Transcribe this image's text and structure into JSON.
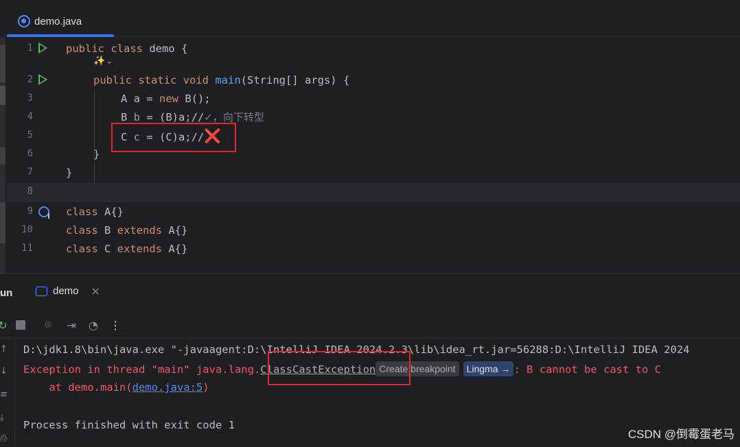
{
  "editor": {
    "tab_label": "demo.java",
    "line_numbers": [
      "1",
      "2",
      "3",
      "4",
      "5",
      "6",
      "7",
      "8",
      "9",
      "10",
      "11"
    ],
    "lines": {
      "l1_kw": "public class",
      "l1_rest": " demo {",
      "l2_kw": "public static void",
      "l2_fn": "main",
      "l2_rest": "(String[] args) {",
      "l3_a": "A a = ",
      "l3_kw": "new",
      "l3_b": " B();",
      "l4_a": "B ",
      "l4_var": "b",
      "l4_b": " = (B)a;//",
      "l4_comment": "✓，向下转型",
      "l5_a": "C ",
      "l5_var": "c",
      "l5_b": " = (C)a;//",
      "l5_cross": "❌",
      "l6": "}",
      "l7": "}",
      "l9_kw": "class",
      "l9_rest": " A{}",
      "l10_kw1": "class",
      "l10_mid": " B ",
      "l10_kw2": "extends",
      "l10_rest": " A{}",
      "l11_kw1": "class",
      "l11_mid": " C ",
      "l11_kw2": "extends",
      "l11_rest": " A{}"
    }
  },
  "run": {
    "title": "un",
    "tab_label": "demo",
    "console": {
      "cmd": "D:\\jdk1.8\\bin\\java.exe \"-javaagent:D:\\IntelliJ IDEA 2024.2.3\\lib\\idea_rt.jar=56288:D:\\IntelliJ IDEA 2024",
      "err_prefix": "Exception in thread \"main\" java.lang.",
      "exception": "ClassCastException",
      "breakpoint_chip": "Create breakpoint",
      "ai_chip": "Lingma →",
      "err_suffix": ": B cannot be cast to C",
      "at_prefix": "    at demo.main(",
      "at_link": "demo.java:5",
      "at_suffix": ")",
      "finished": "Process finished with exit code 1"
    }
  },
  "watermark": "CSDN @倒霉蛋老马",
  "colors": {
    "keyword": "#cf8e6d",
    "function": "#56a8f5",
    "error": "#f75464",
    "link": "#548af7",
    "highlight_box": "#e5262a"
  }
}
